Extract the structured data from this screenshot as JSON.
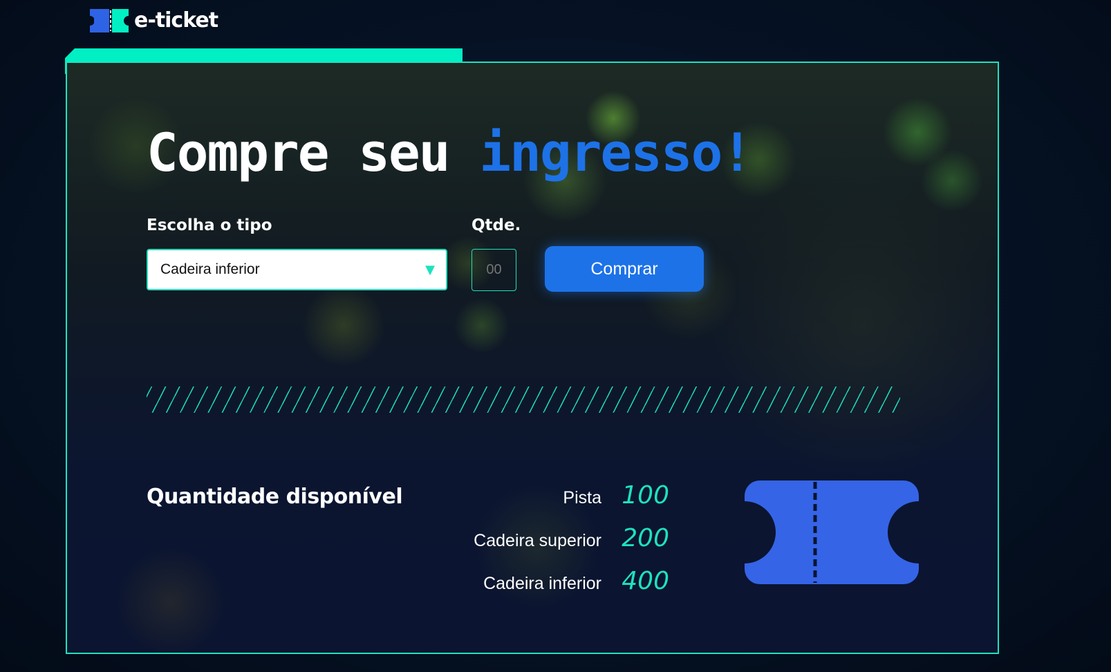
{
  "header": {
    "logo_text": "e-ticket"
  },
  "hero": {
    "headline_part1": "Compre seu ",
    "headline_accent": "ingresso!"
  },
  "form": {
    "type_label": "Escolha o tipo",
    "type_selected": "Cadeira inferior",
    "qty_label": "Qtde.",
    "qty_placeholder": "00",
    "buy_button": "Comprar"
  },
  "availability": {
    "title": "Quantidade disponível",
    "items": [
      {
        "label": "Pista",
        "value": "100"
      },
      {
        "label": "Cadeira superior",
        "value": "200"
      },
      {
        "label": "Cadeira inferior",
        "value": "400"
      }
    ]
  },
  "colors": {
    "accent_teal": "#1de2be",
    "accent_blue": "#1d72e8",
    "ticket_blue": "#3564e6"
  },
  "icons": [
    "ticket-logo-icon",
    "dropdown-caret-icon",
    "ticket-illustration-icon"
  ]
}
